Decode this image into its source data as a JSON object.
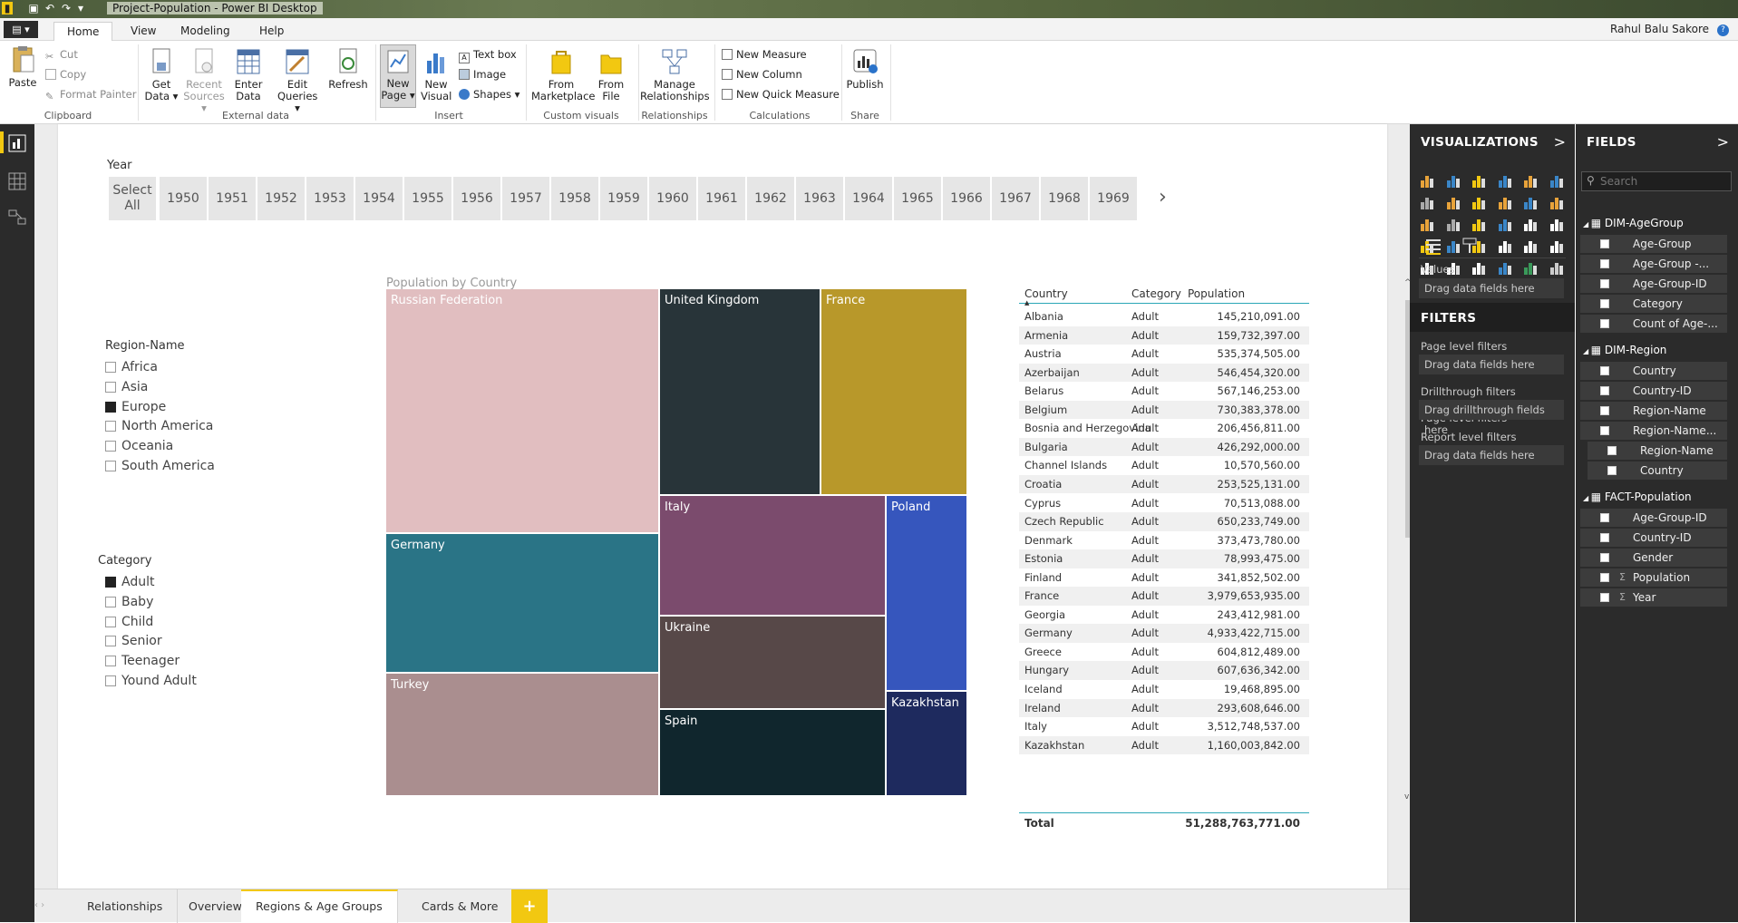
{
  "window": {
    "title": "Project-Population - Power BI Desktop"
  },
  "ribbon_tabs": {
    "file": "▤ ▾",
    "home": "Home",
    "view": "View",
    "modeling": "Modeling",
    "help": "Help",
    "user": "Rahul Balu Sakore",
    "help_icon": "?"
  },
  "ribbon": {
    "paste": "Paste",
    "cut": "Cut",
    "copy": "Copy",
    "format_painter": "Format Painter",
    "get_data": "Get Data ▾",
    "recent_sources": "Recent Sources ▾",
    "enter_data": "Enter Data",
    "edit_queries": "Edit Queries ▾",
    "refresh": "Refresh",
    "new_page": "New Page ▾",
    "new_visual": "New Visual",
    "text_box": "Text box",
    "image": "Image",
    "shapes": "Shapes ▾",
    "from_marketplace": "From Marketplace",
    "from_file": "From File",
    "manage_relationships": "Manage Relationships",
    "new_measure": "New Measure",
    "new_column": "New Column",
    "new_quick_measure": "New Quick Measure",
    "publish": "Publish",
    "groups": {
      "clipboard": "Clipboard",
      "external_data": "External data",
      "insert": "Insert",
      "custom_visuals": "Custom visuals",
      "relationships": "Relationships",
      "calculations": "Calculations",
      "share": "Share"
    }
  },
  "year_slicer": {
    "label": "Year",
    "select_all": "Select All",
    "years": [
      "1950",
      "1951",
      "1952",
      "1953",
      "1954",
      "1955",
      "1956",
      "1957",
      "1958",
      "1959",
      "1960",
      "1961",
      "1962",
      "1963",
      "1964",
      "1965",
      "1966",
      "1967",
      "1968",
      "1969"
    ],
    "next_arrow": "›"
  },
  "region_slicer": {
    "title": "Region-Name",
    "items": [
      {
        "label": "Africa",
        "checked": false
      },
      {
        "label": "Asia",
        "checked": false
      },
      {
        "label": "Europe",
        "checked": true
      },
      {
        "label": "North America",
        "checked": false
      },
      {
        "label": "Oceania",
        "checked": false
      },
      {
        "label": "South America",
        "checked": false
      }
    ]
  },
  "category_slicer": {
    "title": "Category",
    "items": [
      {
        "label": "Adult",
        "checked": true
      },
      {
        "label": "Baby",
        "checked": false
      },
      {
        "label": "Child",
        "checked": false
      },
      {
        "label": "Senior",
        "checked": false
      },
      {
        "label": "Teenager",
        "checked": false
      },
      {
        "label": "Yound Adult",
        "checked": false
      }
    ]
  },
  "treemap": {
    "title": "Population by Country",
    "tiles": [
      {
        "label": "Russian Federation",
        "color": "#e1bec0"
      },
      {
        "label": "Germany",
        "color": "#2a7486"
      },
      {
        "label": "Turkey",
        "color": "#aa8e8f"
      },
      {
        "label": "United Kingdom",
        "color": "#283439"
      },
      {
        "label": "France",
        "color": "#b8982a"
      },
      {
        "label": "Italy",
        "color": "#7b4b6d"
      },
      {
        "label": "Ukraine",
        "color": "#574848"
      },
      {
        "label": "Spain",
        "color": "#10262d"
      },
      {
        "label": "Poland",
        "color": "#3656bd"
      },
      {
        "label": "Kazakhstan",
        "color": "#1e2a5e"
      }
    ]
  },
  "table": {
    "headers": {
      "country": "Country",
      "category": "Category",
      "population": "Population"
    },
    "rows": [
      {
        "country": "Albania",
        "category": "Adult",
        "population": "145,210,091.00"
      },
      {
        "country": "Armenia",
        "category": "Adult",
        "population": "159,732,397.00"
      },
      {
        "country": "Austria",
        "category": "Adult",
        "population": "535,374,505.00"
      },
      {
        "country": "Azerbaijan",
        "category": "Adult",
        "population": "546,454,320.00"
      },
      {
        "country": "Belarus",
        "category": "Adult",
        "population": "567,146,253.00"
      },
      {
        "country": "Belgium",
        "category": "Adult",
        "population": "730,383,378.00"
      },
      {
        "country": "Bosnia and Herzegovina",
        "category": "Adult",
        "population": "206,456,811.00"
      },
      {
        "country": "Bulgaria",
        "category": "Adult",
        "population": "426,292,000.00"
      },
      {
        "country": "Channel Islands",
        "category": "Adult",
        "population": "10,570,560.00"
      },
      {
        "country": "Croatia",
        "category": "Adult",
        "population": "253,525,131.00"
      },
      {
        "country": "Cyprus",
        "category": "Adult",
        "population": "70,513,088.00"
      },
      {
        "country": "Czech Republic",
        "category": "Adult",
        "population": "650,233,749.00"
      },
      {
        "country": "Denmark",
        "category": "Adult",
        "population": "373,473,780.00"
      },
      {
        "country": "Estonia",
        "category": "Adult",
        "population": "78,993,475.00"
      },
      {
        "country": "Finland",
        "category": "Adult",
        "population": "341,852,502.00"
      },
      {
        "country": "France",
        "category": "Adult",
        "population": "3,979,653,935.00"
      },
      {
        "country": "Georgia",
        "category": "Adult",
        "population": "243,412,981.00"
      },
      {
        "country": "Germany",
        "category": "Adult",
        "population": "4,933,422,715.00"
      },
      {
        "country": "Greece",
        "category": "Adult",
        "population": "604,812,489.00"
      },
      {
        "country": "Hungary",
        "category": "Adult",
        "population": "607,636,342.00"
      },
      {
        "country": "Iceland",
        "category": "Adult",
        "population": "19,468,895.00"
      },
      {
        "country": "Ireland",
        "category": "Adult",
        "population": "293,608,646.00"
      },
      {
        "country": "Italy",
        "category": "Adult",
        "population": "3,512,748,537.00"
      },
      {
        "country": "Kazakhstan",
        "category": "Adult",
        "population": "1,160,003,842.00"
      }
    ],
    "total_label": "Total",
    "total_value": "51,288,763,771.00"
  },
  "visualizations_pane": {
    "title": "VISUALIZATIONS",
    "arrow": ">",
    "values_label": "Values",
    "values_drop": "Drag data fields here",
    "filters_title": "FILTERS",
    "page_filters": "Page level filters",
    "page_drop": "Drag data fields here",
    "drill_filters": "Drillthrough filters",
    "drill_drop": "Drag drillthrough fields here",
    "report_filters": "Report level filters",
    "report_drop": "Drag data fields here"
  },
  "fields_pane": {
    "title": "FIELDS",
    "arrow": ">",
    "search_placeholder": "Search",
    "tables": [
      {
        "name": "DIM-AgeGroup",
        "fields": [
          "Age-Group",
          "Age-Group -...",
          "Age-Group-ID",
          "Category",
          "Count of Age-..."
        ]
      },
      {
        "name": "DIM-Region",
        "fields": [
          "Country",
          "Country-ID",
          "Region-Name"
        ],
        "hierarchy": {
          "name": "Region-Name...",
          "levels": [
            "Region-Name",
            "Country"
          ]
        }
      },
      {
        "name": "FACT-Population",
        "fields": [
          "Age-Group-ID",
          "Country-ID",
          "Gender",
          "Population",
          "Year"
        ]
      }
    ]
  },
  "page_tabs": {
    "tabs": [
      "Relationships",
      "Overview",
      "Regions & Age Groups",
      "Cards & More"
    ],
    "add": "+"
  }
}
